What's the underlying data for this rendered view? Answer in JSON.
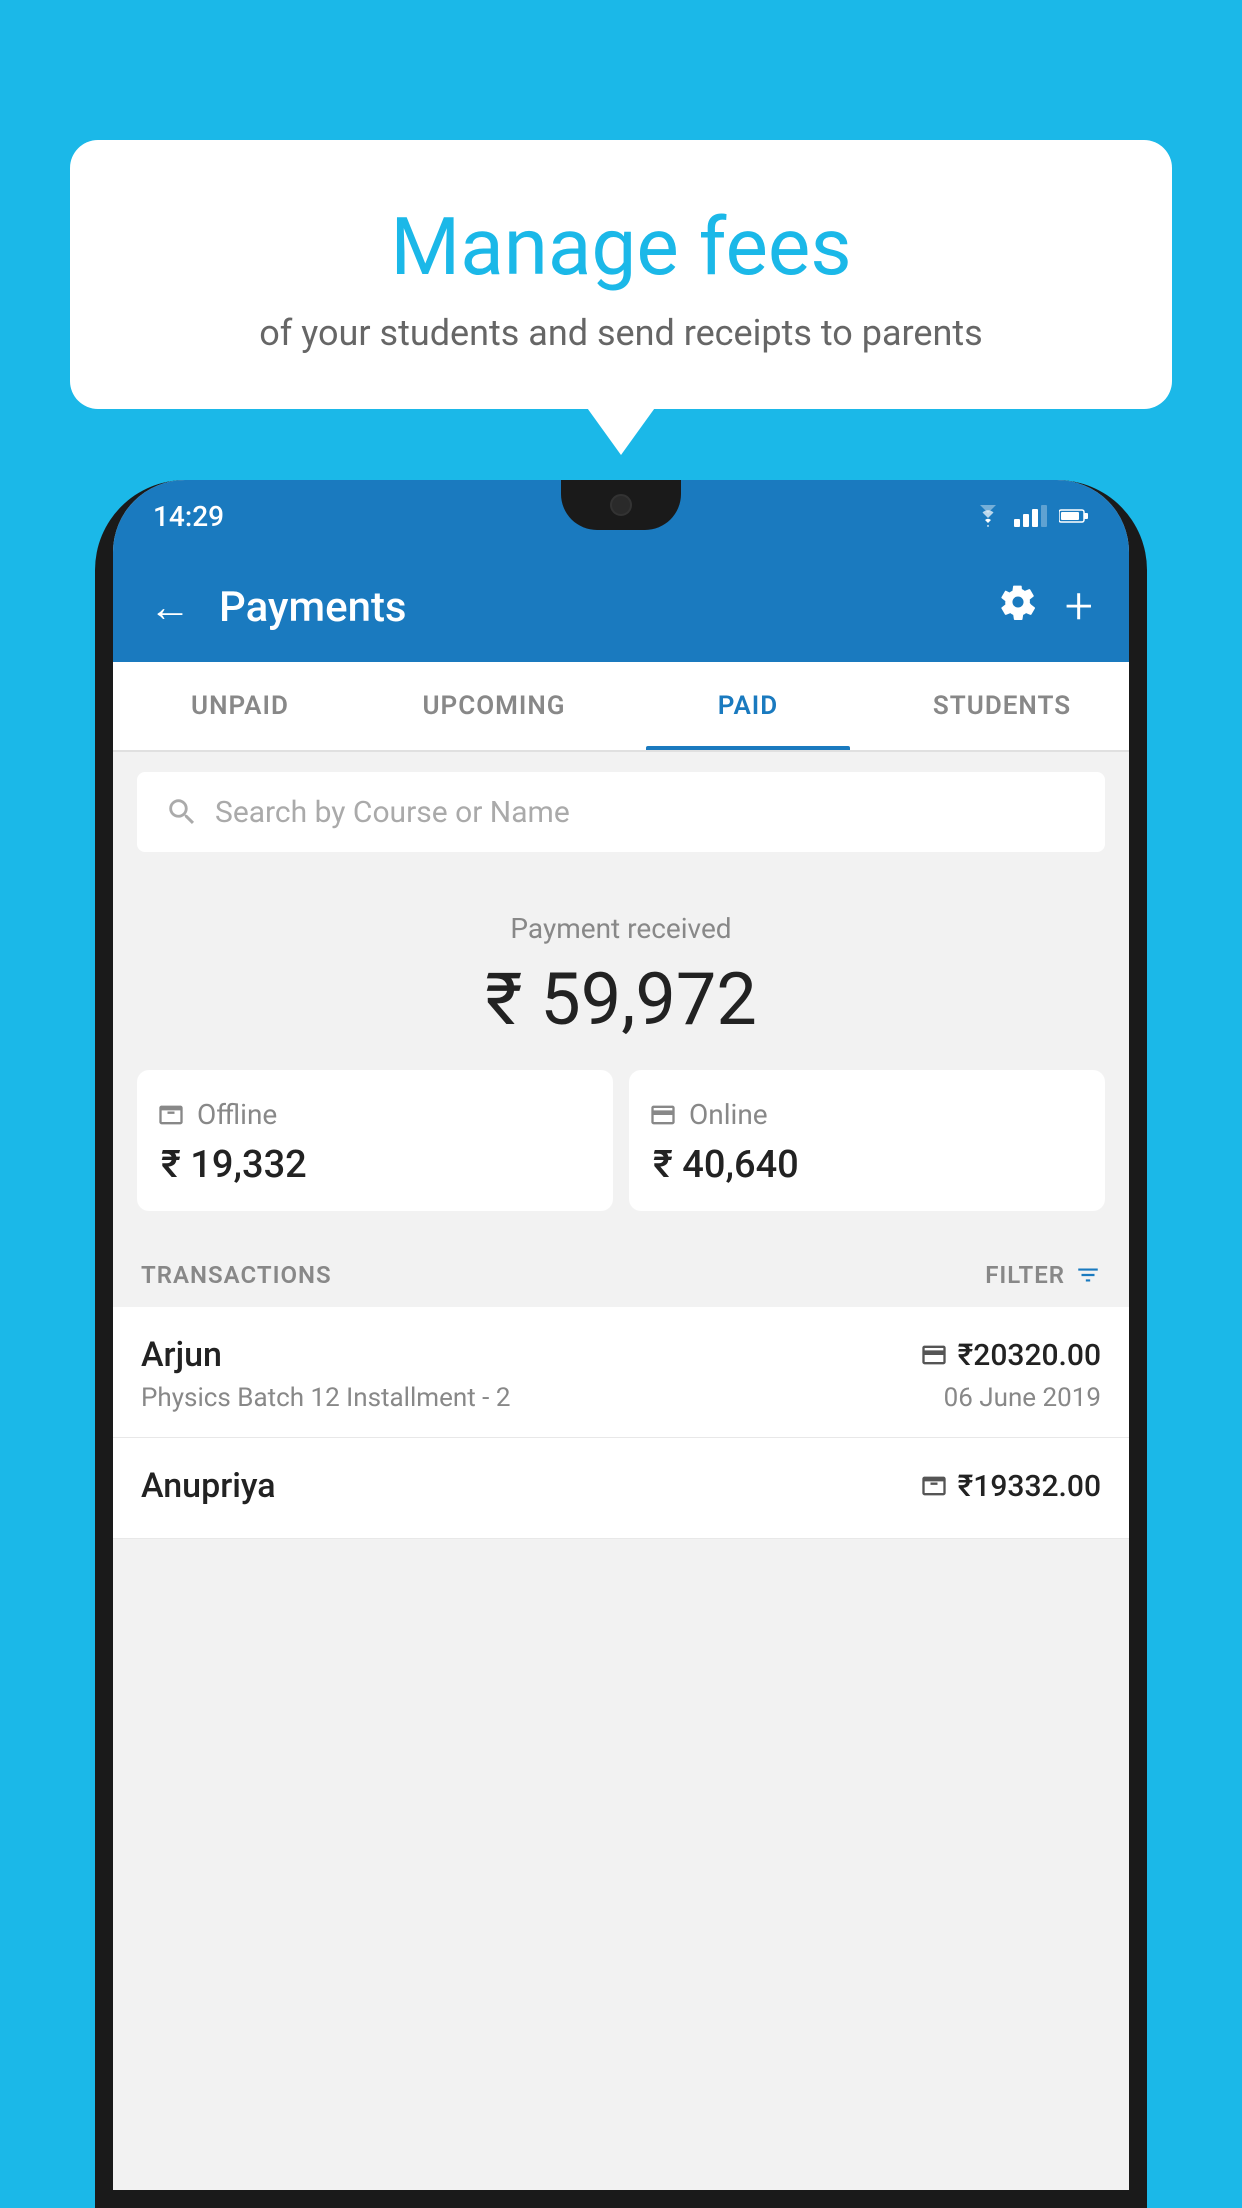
{
  "background_color": "#1BB8E8",
  "speech_bubble": {
    "title": "Manage fees",
    "subtitle": "of your students and send receipts to parents"
  },
  "status_bar": {
    "time": "14:29",
    "wifi": "▾",
    "signal": "▲",
    "battery": "▮"
  },
  "app_bar": {
    "title": "Payments",
    "back_label": "←",
    "settings_label": "⚙",
    "add_label": "+"
  },
  "tabs": [
    {
      "id": "unpaid",
      "label": "UNPAID",
      "active": false
    },
    {
      "id": "upcoming",
      "label": "UPCOMING",
      "active": false
    },
    {
      "id": "paid",
      "label": "PAID",
      "active": true
    },
    {
      "id": "students",
      "label": "STUDENTS",
      "active": false
    }
  ],
  "search": {
    "placeholder": "Search by Course or Name"
  },
  "payment_summary": {
    "label": "Payment received",
    "amount": "₹ 59,972",
    "offline": {
      "label": "Offline",
      "amount": "₹ 19,332"
    },
    "online": {
      "label": "Online",
      "amount": "₹ 40,640"
    }
  },
  "transactions": {
    "header_label": "TRANSACTIONS",
    "filter_label": "FILTER",
    "items": [
      {
        "name": "Arjun",
        "course": "Physics Batch 12 Installment - 2",
        "date": "06 June 2019",
        "amount": "₹20320.00",
        "payment_type": "online"
      },
      {
        "name": "Anupriya",
        "course": "",
        "date": "",
        "amount": "₹19332.00",
        "payment_type": "offline"
      }
    ]
  }
}
